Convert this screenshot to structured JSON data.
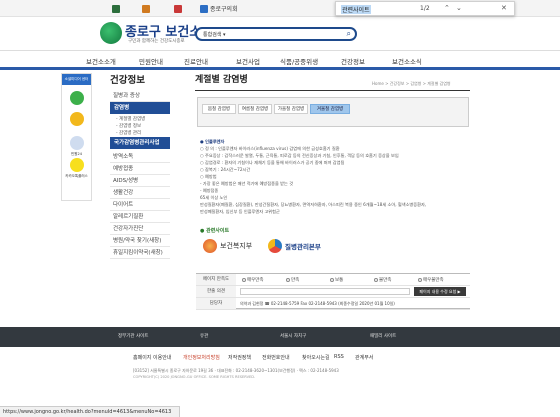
{
  "topbar": {
    "links": [
      {
        "label": "",
        "color": "#2c6e3c"
      },
      {
        "label": "",
        "color": "#d07a20"
      },
      {
        "label": "",
        "color": "#c93838"
      },
      {
        "label": "종로구의회",
        "color": "#2c6ec4"
      }
    ],
    "find": {
      "query": "관련사이트",
      "count": "1/2"
    }
  },
  "header": {
    "logo_title": "종로구 보건소",
    "logo_sub": "구민과 함께하는 건강도시종로",
    "search_select": "통합검색",
    "nav": [
      "보건소소개",
      "민원안내",
      "진료안내",
      "보건사업",
      "식품/공중위생",
      "건강정보",
      "보건소소식"
    ]
  },
  "quick": {
    "title": "소셜미디어 센터",
    "items": [
      {
        "label": "",
        "color": "#3cb04a"
      },
      {
        "label": "",
        "color": "#f2b81c"
      },
      {
        "label": "민원24",
        "color": "#cfdcef"
      },
      {
        "label": "카카오톡플러스",
        "color": "#f7df1e"
      }
    ]
  },
  "lnb": {
    "title": "건강정보",
    "items": [
      {
        "label": "질병과 증상",
        "style": "line"
      },
      {
        "label": "감염병",
        "style": "on"
      },
      {
        "label": "- 계절별 감염병",
        "style": "sub"
      },
      {
        "label": "- 감염병 정보",
        "style": "sub"
      },
      {
        "label": "- 감염병 관리",
        "style": "sub"
      },
      {
        "label": "국가감염병관리사업",
        "style": "on"
      },
      {
        "label": "방역소독",
        "style": "line"
      },
      {
        "label": "예방접종",
        "style": "line"
      },
      {
        "label": "AIDS/성병",
        "style": "line"
      },
      {
        "label": "생활건강",
        "style": "line"
      },
      {
        "label": "다이어트",
        "style": "line"
      },
      {
        "label": "알레르기질환",
        "style": "line"
      },
      {
        "label": "건강자가진단",
        "style": "line"
      },
      {
        "label": "병원/약국 찾기(새창)",
        "style": "line"
      },
      {
        "label": "휴일지킴이약국(새창)",
        "style": "line"
      }
    ]
  },
  "content": {
    "title": "계절별 감염병",
    "breadcrumb": "Home > 건강정보 > 감염병 > 계절별 감염병",
    "tabs": [
      "봄철 감염병",
      "여름철 감염병",
      "가을철 감염병",
      "겨울철 감염병"
    ],
    "active_tab": 3,
    "paragraphs": [
      {
        "text": "● 인플루엔자",
        "h": true
      },
      {
        "text": "○ 정 의 : 인플루엔자 바이러스(influenza virus) 감염에 의한 급성호흡기 질환",
        "h": false
      },
      {
        "text": "○ 주요증상 : 갑작스러운 발열, 두통, 근육통, 피로감 등의 전신증상과 기침, 인후통, 객담 등의 호흡기 증상을 보임",
        "h": false
      },
      {
        "text": "○ 감염경로 : 환자의 기침이나 재채기 등을 통해 바이러스가 공기 중에 퍼져 감염됨",
        "h": false
      },
      {
        "text": "○ 잠복기 : 24시간~72시간",
        "h": false
      },
      {
        "text": "○ 예방법",
        "h": false
      },
      {
        "text": "  - 가장 좋은 예방법은 매년 적기에 예방접종을 받는 것",
        "h": false
      },
      {
        "text": "  - 예방접종",
        "h": false
      },
      {
        "text": "    65세 이상 노인",
        "h": false
      },
      {
        "text": "    만성질환자(폐질환, 심장질환), 만성간질환자, 당뇨병환자, 면역저하환자, 아스피린 복용 중인 6개월~18세 소아, 혈색소병증환자,",
        "h": false
      },
      {
        "text": "    만성폐질환자, 임신부 등 인플루엔자 고위험군",
        "h": false
      }
    ],
    "related_title": "● 관련사이트",
    "related": [
      {
        "label": "보건복지부",
        "color": "#e0512a"
      },
      {
        "label": "질병관리본부",
        "color": "#2a7ac4"
      }
    ]
  },
  "survey": {
    "row1_label": "페이지 만족도",
    "options": [
      "매우만족",
      "만족",
      "보통",
      "불만족",
      "매우불만족"
    ],
    "row2_label": "한줄 의견",
    "row3_label": "담당자",
    "row3_value": "의약과 김현정  ☎ 02-2148-5759  Fax 02-2148-5943  (최종수정일 2020년 01월 10일)",
    "submit": "페이지 내용 수정 요청 ▶"
  },
  "footer": {
    "band": [
      "정부기관 사이트",
      "유관",
      "서울시 자치구",
      "패밀리 사이트"
    ],
    "links": [
      "홈페이지 이용안내",
      "개인정보처리방침",
      "저작권정책",
      "전화번호안내",
      "찾아오시는길",
      "RSS",
      "관계부서"
    ],
    "address": "[03152] 서울특별시 종로구 자하문로 19길 36 · 대표전화 : 02-2148-3620~1301(보건행정) · 팩스 : 02-2148-5943",
    "copyright": "COPYRIGHT(C) 2020 JONGNO-GU OFFICE. SOME RIGHTS RESERVED."
  },
  "status_url": "https://www.jongno.go.kr/health.do?menuId=4613&menuNo=4613"
}
